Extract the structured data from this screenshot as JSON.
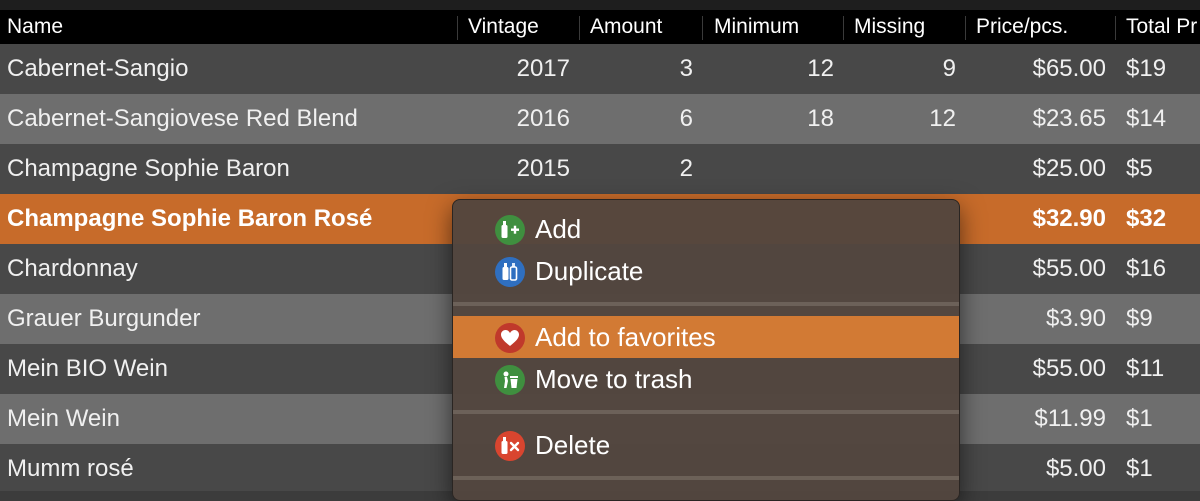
{
  "columns": {
    "name": "Name",
    "vintage": "Vintage",
    "amount": "Amount",
    "minimum": "Minimum",
    "missing": "Missing",
    "price": "Price/pcs.",
    "total": "Total Pr"
  },
  "rows": [
    {
      "name": "Cabernet-Sangio",
      "vintage": "2017",
      "amount": "3",
      "minimum": "12",
      "missing": "9",
      "price": "$65.00",
      "total": "$19"
    },
    {
      "name": "Cabernet-Sangiovese Red Blend",
      "vintage": "2016",
      "amount": "6",
      "minimum": "18",
      "missing": "12",
      "price": "$23.65",
      "total": "$14"
    },
    {
      "name": "Champagne Sophie Baron",
      "vintage": "2015",
      "amount": "2",
      "minimum": "",
      "missing": "",
      "price": "$25.00",
      "total": "$5"
    },
    {
      "name": "Champagne Sophie Baron Rosé",
      "vintage": "",
      "amount": "",
      "minimum": "",
      "missing": "",
      "price": "$32.90",
      "total": "$32"
    },
    {
      "name": "Chardonnay",
      "vintage": "",
      "amount": "",
      "minimum": "",
      "missing": "",
      "price": "$55.00",
      "total": "$16"
    },
    {
      "name": "Grauer Burgunder",
      "vintage": "",
      "amount": "",
      "minimum": "",
      "missing": "",
      "price": "$3.90",
      "total": "$9"
    },
    {
      "name": "Mein BIO Wein",
      "vintage": "",
      "amount": "",
      "minimum": "",
      "missing": "",
      "price": "$55.00",
      "total": "$11"
    },
    {
      "name": "Mein Wein",
      "vintage": "",
      "amount": "",
      "minimum": "",
      "missing": "",
      "price": "$11.99",
      "total": "$1"
    },
    {
      "name": "Mumm rosé",
      "vintage": "",
      "amount": "",
      "minimum": "",
      "missing": "",
      "price": "$5.00",
      "total": "$1"
    }
  ],
  "context_menu": {
    "add": {
      "label": "Add",
      "icon": "bottle-add-icon",
      "color": "#3f8f3f"
    },
    "duplicate": {
      "label": "Duplicate",
      "icon": "bottles-duplicate-icon",
      "color": "#2f6fc0"
    },
    "favorites": {
      "label": "Add to favorites",
      "icon": "heart-icon",
      "color": "#c0392b"
    },
    "trash": {
      "label": "Move to trash",
      "icon": "trash-icon",
      "color": "#3f8f3f"
    },
    "delete": {
      "label": "Delete",
      "icon": "bottle-delete-icon",
      "color": "#d9452f"
    }
  },
  "colors": {
    "selection": "#c76b2a",
    "menu_hover": "#d27a34",
    "header": "#000000"
  }
}
